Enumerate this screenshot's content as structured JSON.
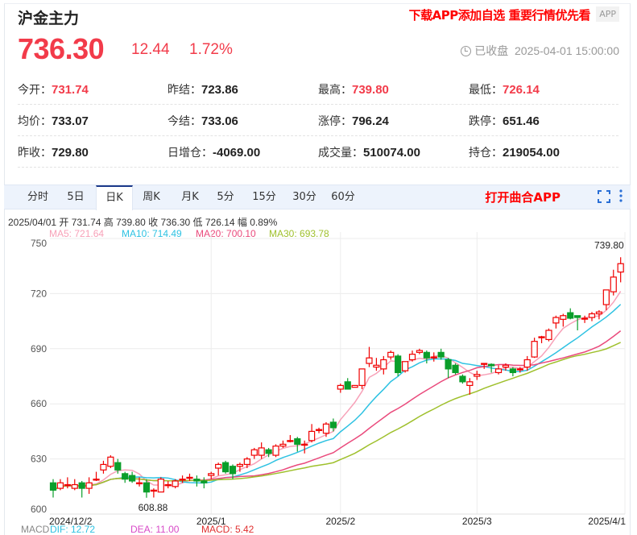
{
  "header": {
    "title": "沪金主力",
    "promo": "下载APP添加自选 重要行情优先看",
    "app_badge": "APP",
    "price": "736.30",
    "change": "12.44",
    "change_pct": "1.72%",
    "status": "已收盘",
    "datetime": "2025-04-01 15:00:00",
    "clock_icon": "clock-icon"
  },
  "stats": [
    [
      {
        "label": "今开：",
        "value": "731.74",
        "red": true
      },
      {
        "label": "昨结：",
        "value": "723.86"
      },
      {
        "label": "最高：",
        "value": "739.80",
        "red": true
      },
      {
        "label": "最低：",
        "value": "726.14",
        "red": true
      }
    ],
    [
      {
        "label": "均价：",
        "value": "733.07"
      },
      {
        "label": "今结：",
        "value": "733.06"
      },
      {
        "label": "涨停：",
        "value": "796.24"
      },
      {
        "label": "跌停：",
        "value": "651.46"
      }
    ],
    [
      {
        "label": "昨收：",
        "value": "729.80"
      },
      {
        "label": "日增仓：",
        "value": "-4069.00"
      },
      {
        "label": "成交量：",
        "value": "510074.00"
      },
      {
        "label": "持仓：",
        "value": "219054.00"
      }
    ]
  ],
  "tabs": [
    "分时",
    "5日",
    "日K",
    "周K",
    "月K",
    "5分",
    "15分",
    "30分",
    "60分"
  ],
  "active_tab": "日K",
  "open_app": "打开曲合APP",
  "info_line": "2025/04/01  开 731.74  高 739.80  收 736.30  低 726.14  幅 0.89%",
  "ma_legend": [
    {
      "text": "MA5: 721.64",
      "color": "#f7a1b8"
    },
    {
      "text": "MA10: 714.49",
      "color": "#2ec2e2"
    },
    {
      "text": "MA20: 700.10",
      "color": "#ea4a7c"
    },
    {
      "text": "MA30: 693.78",
      "color": "#9fc02c"
    }
  ],
  "macd_legend": [
    {
      "text": "MACD",
      "color": "#888"
    },
    {
      "text": "DIF: 12.72",
      "color": "#2ec2e2"
    },
    {
      "text": "DEA: 11.00",
      "color": "#d84bc8"
    },
    {
      "text": "MACD: 5.42",
      "color": "#e03030"
    }
  ],
  "colors": {
    "up": "#f00000",
    "down": "#0a9e2a",
    "accent": "#f23b4a"
  },
  "chart_data": {
    "type": "candlestick",
    "yticks": [
      750,
      720,
      690,
      660,
      630,
      600
    ],
    "ylim": [
      600,
      750
    ],
    "xticks": [
      {
        "label": "2024/12/2",
        "index": 0
      },
      {
        "label": "2025/1",
        "index": 22
      },
      {
        "label": "2025/2",
        "index": 40
      },
      {
        "label": "2025/3",
        "index": 59
      },
      {
        "label": "2025/4/1",
        "index": 79
      }
    ],
    "max_label": "739.80",
    "min_label": "608.88",
    "max_index": 79,
    "min_index": 13,
    "ohlc": [
      [
        617,
        619,
        609,
        613
      ],
      [
        614,
        619,
        613,
        617
      ],
      [
        616,
        620,
        614,
        616
      ],
      [
        614,
        619,
        613,
        616
      ],
      [
        617,
        618,
        609,
        614
      ],
      [
        614,
        620,
        611,
        617
      ],
      [
        619,
        623,
        618,
        619
      ],
      [
        624,
        629,
        622,
        627
      ],
      [
        626,
        632,
        625,
        631
      ],
      [
        628,
        630,
        622,
        624
      ],
      [
        622,
        623,
        617,
        619
      ],
      [
        621,
        623,
        617,
        618
      ],
      [
        617,
        620,
        615,
        617
      ],
      [
        617,
        619,
        608.88,
        612
      ],
      [
        613,
        614,
        609,
        613
      ],
      [
        612,
        620,
        612,
        619
      ],
      [
        616,
        618,
        614,
        616
      ],
      [
        615,
        619,
        614,
        618
      ],
      [
        619,
        621,
        617,
        619
      ],
      [
        620,
        622,
        618,
        620
      ],
      [
        619,
        621,
        615,
        618
      ],
      [
        618,
        620,
        614,
        617
      ],
      [
        621,
        623,
        619,
        622
      ],
      [
        625,
        628,
        621,
        627
      ],
      [
        628,
        629,
        622,
        623
      ],
      [
        626,
        627,
        619,
        622
      ],
      [
        626,
        628,
        623,
        627
      ],
      [
        627,
        631,
        625,
        630
      ],
      [
        632,
        636,
        630,
        635
      ],
      [
        632,
        639,
        630,
        636
      ],
      [
        635,
        636,
        631,
        633
      ],
      [
        632,
        638,
        631,
        637
      ],
      [
        637,
        640,
        636,
        638
      ],
      [
        640,
        643,
        639,
        640
      ],
      [
        641,
        642,
        634,
        638
      ],
      [
        638,
        640,
        633,
        638
      ],
      [
        640,
        649,
        639,
        645
      ],
      [
        646,
        647,
        644,
        646
      ],
      [
        644,
        650,
        642,
        649
      ],
      [
        650,
        652,
        645,
        647
      ],
      [
        668,
        671,
        666,
        670
      ],
      [
        672,
        674,
        668,
        668
      ],
      [
        669,
        670,
        669,
        670
      ],
      [
        670,
        679,
        668,
        679
      ],
      [
        682,
        691,
        680,
        685
      ],
      [
        680,
        685,
        678,
        681
      ],
      [
        679,
        686,
        676,
        684
      ],
      [
        685.5,
        689,
        684,
        688
      ],
      [
        686,
        687,
        675,
        677
      ],
      [
        678,
        683,
        677,
        683
      ],
      [
        684,
        689,
        683,
        687
      ],
      [
        688,
        690,
        687,
        689
      ],
      [
        688,
        689,
        682,
        685
      ],
      [
        685,
        688,
        683,
        685.5
      ],
      [
        688,
        690,
        684,
        685.5
      ],
      [
        684,
        685,
        674,
        679
      ],
      [
        681,
        682,
        676,
        677
      ],
      [
        675,
        676,
        671,
        672
      ],
      [
        670,
        674,
        665,
        672
      ],
      [
        675,
        678,
        673,
        676
      ],
      [
        682,
        682,
        679,
        682
      ],
      [
        681.5,
        682,
        677,
        680.7
      ],
      [
        677,
        681,
        676,
        679
      ],
      [
        680,
        682,
        678,
        681
      ],
      [
        679,
        680,
        675,
        677
      ],
      [
        679,
        680,
        677,
        679
      ],
      [
        680,
        686,
        678,
        684
      ],
      [
        685.5,
        696,
        685,
        694
      ],
      [
        696.5,
        697,
        693,
        696.5
      ],
      [
        695,
        701,
        694,
        700
      ],
      [
        704,
        708,
        701,
        707
      ],
      [
        706,
        709,
        702,
        708
      ],
      [
        709.6,
        712,
        706,
        706.6
      ],
      [
        708,
        708,
        700,
        707
      ],
      [
        706.6,
        708,
        704,
        706.6
      ],
      [
        707,
        710,
        705,
        709
      ],
      [
        709,
        711,
        706,
        710
      ],
      [
        714,
        722,
        711,
        722
      ],
      [
        721,
        733,
        719,
        729
      ],
      [
        731.74,
        739.8,
        726.14,
        736.3
      ]
    ]
  }
}
